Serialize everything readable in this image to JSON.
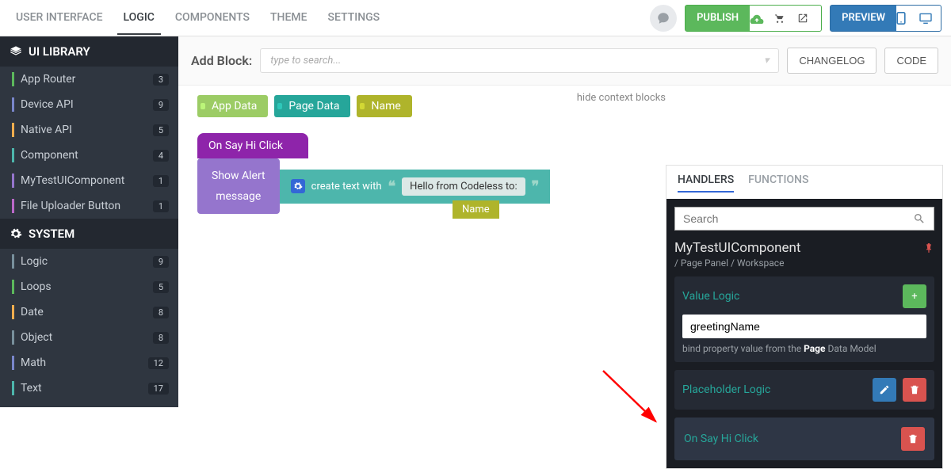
{
  "topbar": {
    "tabs": [
      "USER INTERFACE",
      "LOGIC",
      "COMPONENTS",
      "THEME",
      "SETTINGS"
    ],
    "activeTab": 1,
    "publish": "PUBLISH",
    "preview": "PREVIEW",
    "changelog": "CHANGELOG",
    "code": "CODE"
  },
  "sidebar": {
    "uiLibrary": "UI LIBRARY",
    "system": "SYSTEM",
    "uiItems": [
      {
        "label": "App Router",
        "count": "3",
        "accent": "a-green"
      },
      {
        "label": "Device API",
        "count": "9",
        "accent": "a-blue"
      },
      {
        "label": "Native API",
        "count": "5",
        "accent": "a-orange"
      },
      {
        "label": "Component",
        "count": "4",
        "accent": "a-teal"
      },
      {
        "label": "MyTestUIComponent",
        "count": "1",
        "accent": "a-purple"
      },
      {
        "label": "File Uploader Button",
        "count": "1",
        "accent": "a-pink"
      }
    ],
    "sysItems": [
      {
        "label": "Logic",
        "count": "9",
        "accent": "a-slate"
      },
      {
        "label": "Loops",
        "count": "5",
        "accent": "a-green"
      },
      {
        "label": "Date",
        "count": "8",
        "accent": "a-orange"
      },
      {
        "label": "Object",
        "count": "8",
        "accent": "a-slate"
      },
      {
        "label": "Math",
        "count": "12",
        "accent": "a-blue"
      },
      {
        "label": "Text",
        "count": "17",
        "accent": "a-teal"
      }
    ]
  },
  "addBlock": {
    "label": "Add Block:",
    "placeholder": "type to search..."
  },
  "canvas": {
    "hideContext": "hide context blocks",
    "context": [
      "App Data",
      "Page Data",
      "Name"
    ],
    "hat": "On Say Hi Click",
    "showAlert": "Show Alert",
    "messageLabel": "message",
    "createText": "create text with",
    "hello": "Hello from Codeless to:",
    "name": "Name"
  },
  "rpanel": {
    "tabs": [
      "HANDLERS",
      "FUNCTIONS"
    ],
    "activeTab": 0,
    "searchPlaceholder": "Search",
    "title": "MyTestUIComponent",
    "subtitle": "/ Page Panel / Workspace",
    "valueLogic": "Value Logic",
    "binding": "greetingName",
    "bindHintPrefix": "bind property value from the ",
    "bindHintBold": "Page",
    "bindHintSuffix": " Data Model",
    "placeholderLogic": "Placeholder Logic",
    "onSayHi": "On Say Hi Click"
  },
  "icons": {
    "stack": "☰",
    "gear": "⚙",
    "chat": "💬",
    "cloud": "☁",
    "cart": "🛒",
    "external": "↗",
    "phone": "📱",
    "desktop": "🖥",
    "pin": "📌",
    "plus": "+",
    "edit": "✎",
    "trash": "🗑",
    "search": "🔍",
    "chevron": "▾"
  }
}
